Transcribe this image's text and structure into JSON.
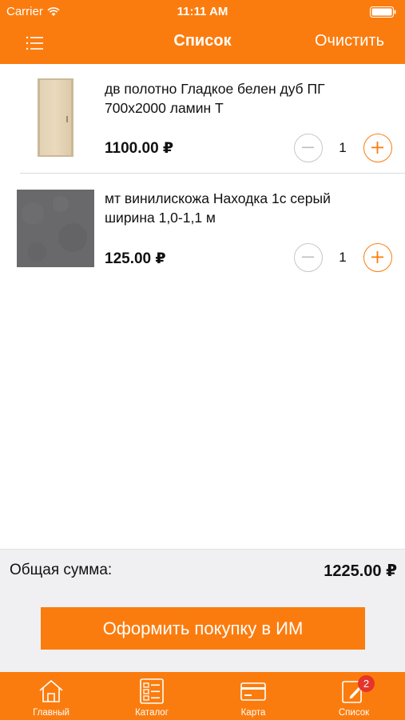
{
  "status_bar": {
    "carrier": "Carrier",
    "time": "11:11 AM"
  },
  "nav": {
    "title": "Список",
    "clear_label": "Очистить"
  },
  "items": [
    {
      "name": "дв полотно Гладкое белен дуб ПГ 700x2000 ламин Т",
      "price": "1100.00 ₽",
      "quantity": "1",
      "image": "door-panel-image"
    },
    {
      "name": "мт винилискожа Находка 1с серый ширина 1,0-1,1 м",
      "price": "125.00 ₽",
      "quantity": "1",
      "image": "gray-vinyl-swatch-image"
    }
  ],
  "summary": {
    "total_label": "Общая сумма:",
    "total_value": "1225.00 ₽",
    "checkout_label": "Оформить покупку в ИМ"
  },
  "tabs": [
    {
      "label": "Главный",
      "icon": "home-icon"
    },
    {
      "label": "Каталог",
      "icon": "catalog-icon"
    },
    {
      "label": "Карта",
      "icon": "card-icon"
    },
    {
      "label": "Список",
      "icon": "list-edit-icon",
      "badge": "2"
    }
  ],
  "colors": {
    "accent": "#fb7c0e",
    "badge": "#e5342a",
    "summary_bg": "#f0f0f3"
  }
}
